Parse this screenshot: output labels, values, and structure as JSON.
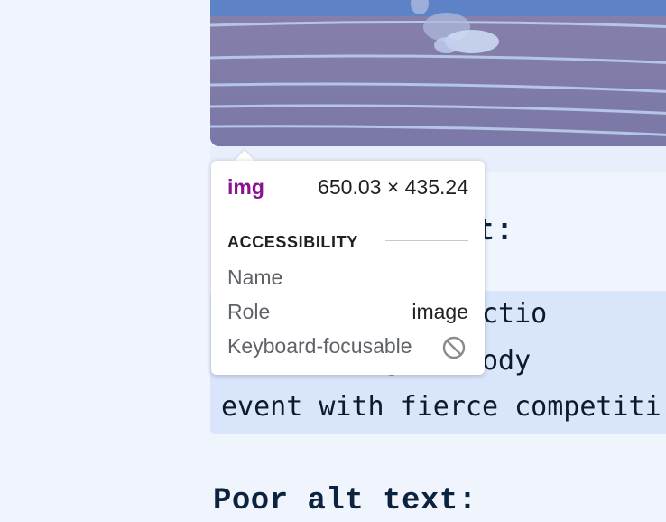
{
  "page": {
    "good_heading_visible": "t:",
    "poor_heading": "Poor alt text:",
    "alt_text_lines": [
      "        man in actio",
      "        d gold body ",
      "event with fierce competiti"
    ]
  },
  "tooltip": {
    "tag": "img",
    "size": "650.03 × 435.24",
    "section": "ACCESSIBILITY",
    "rows": {
      "name_label": "Name",
      "role_label": "Role",
      "role_value": "image",
      "keyboard_label": "Keyboard-focusable",
      "keyboard_icon": "not-allowed-icon"
    }
  },
  "colors": {
    "tag_color": "#881391",
    "heading_color": "#0c2340",
    "alt_box_bg": "#d8e5fb",
    "page_bg": "#f0f4fd"
  }
}
